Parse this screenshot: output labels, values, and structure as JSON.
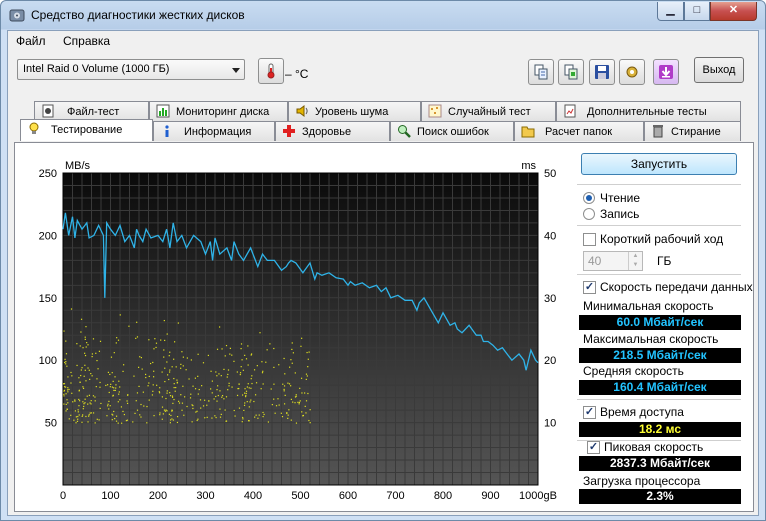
{
  "window": {
    "title": "Средство диагностики жестких дисков"
  },
  "menu": [
    "Файл",
    "Справка"
  ],
  "toolbar": {
    "drive": "Intel   Raid 0 Volume (1000 ГБ)",
    "temperature": "– °C",
    "exit_label": "Выход"
  },
  "tabs_top": [
    "Файл-тест",
    "Мониторинг диска",
    "Уровень шума",
    "Случайный тест",
    "Дополнительные тесты"
  ],
  "tabs_bottom": [
    "Тестирование",
    "Информация",
    "Здоровье",
    "Поиск ошибок",
    "Расчет папок",
    "Стирание"
  ],
  "side": {
    "start_label": "Запустить",
    "read_label": "Чтение",
    "write_label": "Запись",
    "short_stroke_label": "Короткий рабочий ход",
    "short_stroke_value": "40",
    "short_stroke_unit": "ГБ",
    "transfer_label": "Скорость передачи данных",
    "min_label": "Минимальная скорость",
    "min_value": "60.0 Мбайт/сек",
    "max_label": "Максимальная скорость",
    "max_value": "218.5 Мбайт/сек",
    "avg_label": "Средняя скорость",
    "avg_value": "160.4 Мбайт/сек",
    "access_label": "Время доступа",
    "access_value": "18.2 мс",
    "burst_label": "Пиковая скорость",
    "burst_value": "2837.3 Мбайт/сек",
    "cpu_label": "Загрузка процессора",
    "cpu_value": "2.3%"
  },
  "chart_data": {
    "type": "line",
    "ylabel_left": "MB/s",
    "ylabel_right": "ms",
    "ylim_left": [
      0,
      250
    ],
    "ylim_right": [
      0,
      50
    ],
    "xlim": [
      0,
      1000
    ],
    "x_ticks": [
      "0",
      "100",
      "200",
      "300",
      "400",
      "500",
      "600",
      "700",
      "800",
      "900",
      "1000gB"
    ],
    "y_ticks_left": [
      "250",
      "200",
      "150",
      "100",
      "50"
    ],
    "y_ticks_right": [
      "50",
      "40",
      "30",
      "20",
      "10"
    ],
    "grid": true,
    "series": [
      {
        "kind": "line",
        "color": "#2fb3e8",
        "x": [
          0,
          5,
          12,
          20,
          25,
          30,
          40,
          50,
          55,
          65,
          75,
          85,
          88,
          92,
          100,
          110,
          120,
          130,
          140,
          150,
          155,
          160,
          168,
          175,
          185,
          200,
          210,
          218,
          225,
          232,
          240,
          250,
          260,
          275,
          290,
          300,
          310,
          315,
          320,
          330,
          345,
          355,
          360,
          370,
          380,
          395,
          410,
          420,
          430,
          445,
          460,
          470,
          475,
          480,
          490,
          505,
          520,
          530,
          535,
          545,
          560,
          575,
          590,
          600,
          605,
          615,
          630,
          645,
          660,
          670,
          680,
          690,
          705,
          720,
          735,
          745,
          750,
          760,
          775,
          790,
          800,
          815,
          825,
          830,
          840,
          855,
          870,
          880,
          885,
          895,
          905,
          915,
          925,
          935,
          945,
          960,
          970,
          975,
          985,
          995,
          1000
        ],
        "y": [
          205,
          218,
          200,
          215,
          198,
          212,
          205,
          210,
          198,
          200,
          208,
          200,
          150,
          210,
          205,
          200,
          208,
          195,
          200,
          190,
          205,
          200,
          195,
          205,
          198,
          200,
          195,
          205,
          190,
          210,
          195,
          200,
          190,
          200,
          195,
          185,
          195,
          180,
          198,
          185,
          190,
          180,
          195,
          185,
          180,
          190,
          175,
          185,
          180,
          180,
          172,
          175,
          178,
          180,
          178,
          170,
          178,
          165,
          170,
          168,
          170,
          166,
          165,
          160,
          163,
          160,
          162,
          158,
          160,
          155,
          158,
          150,
          152,
          148,
          148,
          140,
          146,
          150,
          140,
          130,
          138,
          128,
          130,
          125,
          122,
          128,
          120,
          120,
          115,
          115,
          112,
          108,
          110,
          105,
          100,
          105,
          100,
          92,
          108,
          100,
          98
        ]
      },
      {
        "kind": "scatter",
        "color": "#e0e020",
        "note": "access time points",
        "y_range_ms": [
          10,
          30
        ]
      }
    ]
  }
}
